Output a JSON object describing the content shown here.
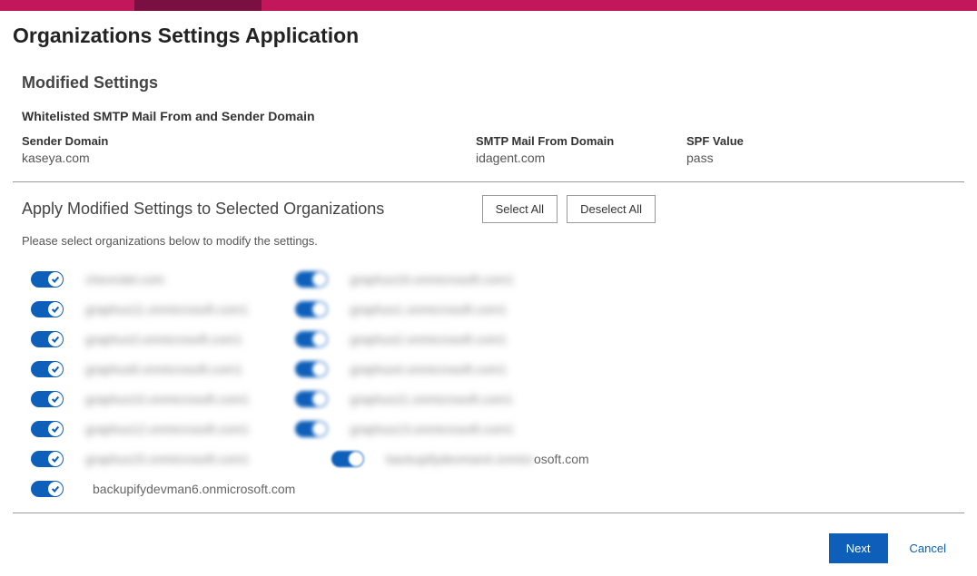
{
  "page_title": "Organizations Settings Application",
  "modified": {
    "heading": "Modified Settings",
    "sub_heading": "Whitelisted SMTP Mail From and Sender Domain",
    "sender_domain_label": "Sender Domain",
    "sender_domain_value": "kaseya.com",
    "smtp_label": "SMTP Mail From Domain",
    "smtp_value": "idagent.com",
    "spf_label": "SPF Value",
    "spf_value": "pass"
  },
  "apply": {
    "heading": "Apply Modified Settings to Selected Organizations",
    "select_all": "Select All",
    "deselect_all": "Deselect All",
    "instruction": "Please select organizations below to modify the settings."
  },
  "orgs": {
    "col1": [
      {
        "label": "chevrolet.com",
        "blurred": true
      },
      {
        "label": "graphus11.onmicrosoft.com1",
        "blurred": true
      },
      {
        "label": "graphus3.onmicrosoft.com1",
        "blurred": true
      },
      {
        "label": "graphus8.onmicrosoft.com1",
        "blurred": true
      },
      {
        "label": "graphus10.onmicrosoft.com1",
        "blurred": true
      },
      {
        "label": "graphus12.onmicrosoft.com1",
        "blurred": true
      },
      {
        "label": "graphus15.onmicrosoft.com1",
        "blurred": true
      },
      {
        "label": "backupifydevman6.onmicrosoft.com",
        "blurred": false
      }
    ],
    "col2": [
      {
        "label": "graphus16.onmicrosoft.com1",
        "blurred": true
      },
      {
        "label": "graphus1.onmicrosoft.com1",
        "blurred": true
      },
      {
        "label": "graphus2.onmicrosoft.com1",
        "blurred": true
      },
      {
        "label": "graphus4.onmicrosoft.com1",
        "blurred": true
      },
      {
        "label": "graphus11.onmicrosoft.com1",
        "blurred": true
      },
      {
        "label": "graphus13.onmicrosoft.com1",
        "blurred": true
      },
      {
        "label": "backupifydevman4.onmicrosoft.com",
        "blurred": true,
        "partial": true
      }
    ]
  },
  "footer": {
    "next": "Next",
    "cancel": "Cancel"
  }
}
